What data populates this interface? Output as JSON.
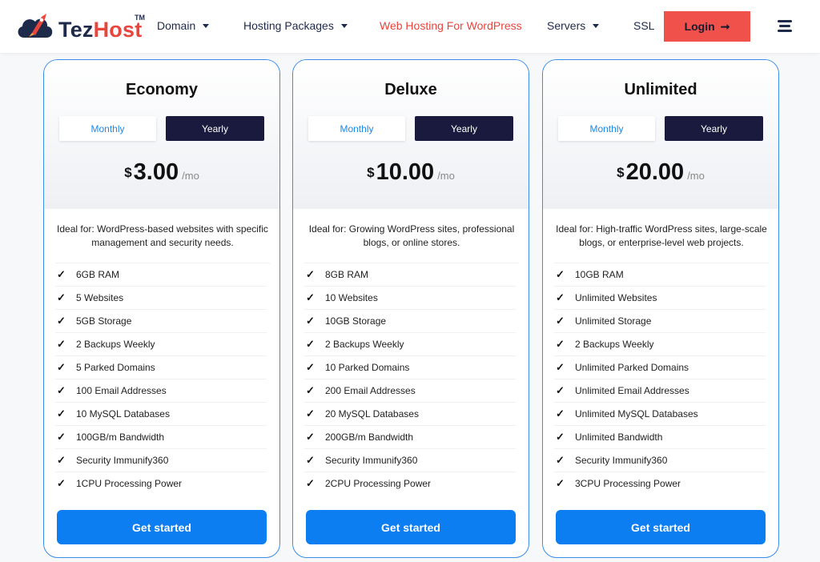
{
  "brand": {
    "name_part1": "Tez",
    "name_part2": "Host",
    "trademark": "TM",
    "icon": "rocket-cloud-icon",
    "colors": {
      "navy": "#1e2a4a",
      "red": "#e8453c"
    }
  },
  "nav": {
    "items": [
      {
        "label": "Domain",
        "dropdown": true
      },
      {
        "label": "Hosting Packages",
        "dropdown": true
      },
      {
        "label": "Web Hosting For WordPress",
        "dropdown": false,
        "active": true
      },
      {
        "label": "Servers",
        "dropdown": true
      },
      {
        "label": "SSL",
        "dropdown": false
      }
    ],
    "login_label": "Login",
    "login_icon": "arrow-right-icon",
    "menu_icon": "hamburger-menu-icon"
  },
  "colors": {
    "accent_blue": "#0d7ef2",
    "card_border": "#3a8ee8",
    "dark_toggle": "#1a1a3e",
    "login_red": "#f0514a",
    "active_link": "#e8453c"
  },
  "plans": [
    {
      "name": "Economy",
      "toggle": {
        "monthly": "Monthly",
        "yearly": "Yearly",
        "selected": "Yearly"
      },
      "price": {
        "currency": "$",
        "amount": "3.00",
        "period": "/mo"
      },
      "ideal": "Ideal for: WordPress-based websites with specific management and security needs.",
      "features": [
        "6GB RAM",
        "5 Websites",
        "5GB Storage",
        "2 Backups Weekly",
        "5 Parked Domains",
        "100 Email Addresses",
        "10 MySQL Databases",
        "100GB/m Bandwidth",
        "Security Immunify360",
        "1CPU Processing Power"
      ],
      "cta": "Get started"
    },
    {
      "name": "Deluxe",
      "toggle": {
        "monthly": "Monthly",
        "yearly": "Yearly",
        "selected": "Yearly"
      },
      "price": {
        "currency": "$",
        "amount": "10.00",
        "period": "/mo"
      },
      "ideal": "Ideal for: Growing WordPress sites, professional blogs, or online stores.",
      "features": [
        "8GB RAM",
        "10 Websites",
        "10GB Storage",
        "2 Backups Weekly",
        "10 Parked Domains",
        "200 Email Addresses",
        "20 MySQL Databases",
        "200GB/m Bandwidth",
        "Security Immunify360",
        "2CPU Processing Power"
      ],
      "cta": "Get started"
    },
    {
      "name": "Unlimited",
      "toggle": {
        "monthly": "Monthly",
        "yearly": "Yearly",
        "selected": "Yearly"
      },
      "price": {
        "currency": "$",
        "amount": "20.00",
        "period": "/mo"
      },
      "ideal": "Ideal for: High-traffic WordPress sites, large-scale blogs, or enterprise-level web projects.",
      "features": [
        "10GB RAM",
        "Unlimited Websites",
        "Unlimited Storage",
        "2 Backups Weekly",
        "Unlimited Parked Domains",
        "Unlimited Email Addresses",
        "Unlimited MySQL Databases",
        "Unlimited Bandwidth",
        "Security Immunify360",
        "3CPU Processing Power"
      ],
      "cta": "Get started"
    }
  ],
  "check_glyph": "✓"
}
